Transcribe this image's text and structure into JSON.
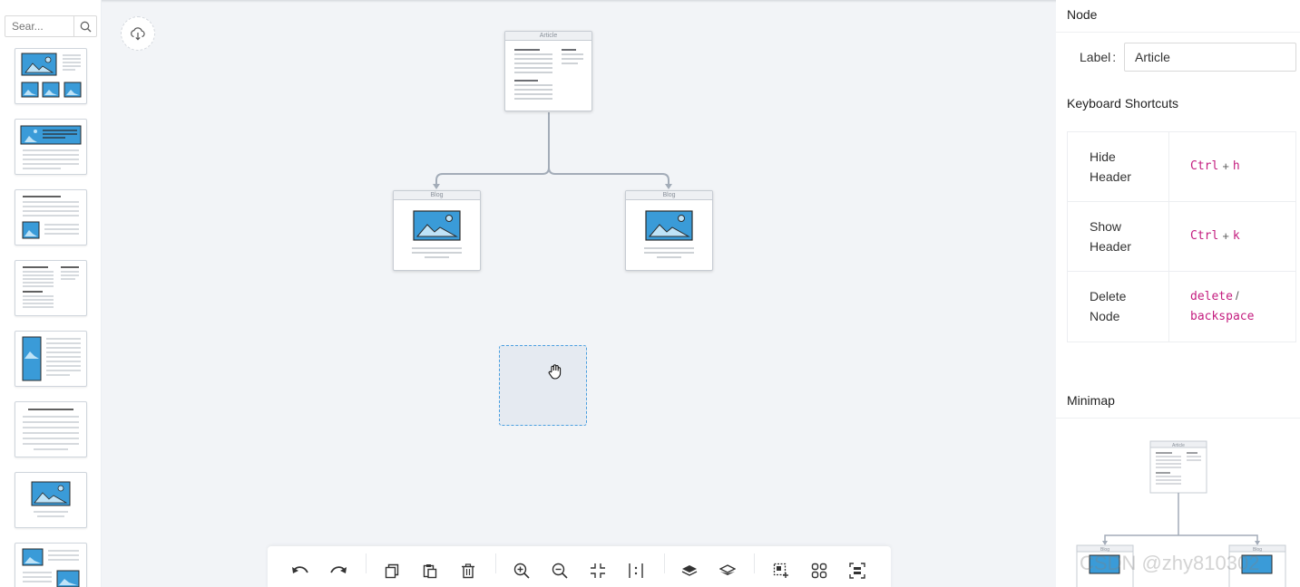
{
  "sidebar": {
    "search": {
      "placeholder": "Sear..."
    },
    "templates": [
      "template-hero-with-gallery",
      "template-banner-text",
      "template-text-image",
      "template-two-column-text",
      "template-image-left-text",
      "template-text-only",
      "template-single-image",
      "template-image-grid"
    ]
  },
  "canvas": {
    "nodes": [
      {
        "id": "article",
        "title": "Article"
      },
      {
        "id": "blog-left",
        "title": "Blog"
      },
      {
        "id": "blog-right",
        "title": "Blog"
      }
    ]
  },
  "toolbar": {
    "icons": [
      "undo-icon",
      "redo-icon",
      "copy-icon",
      "paste-icon",
      "delete-icon",
      "zoom-in-icon",
      "zoom-out-icon",
      "fit-view-icon",
      "actual-size-icon",
      "bring-to-front-icon",
      "send-to-back-icon",
      "multi-select-icon",
      "group-icon",
      "ungroup-icon"
    ]
  },
  "panel": {
    "node_section_title": "Node",
    "label_caption": "Label",
    "label_colon": ":",
    "label_value": "Article",
    "shortcuts_title": "Keyboard Shortcuts",
    "shortcuts": [
      {
        "action_line1": "Hide",
        "action_line2": "Header",
        "key1": "Ctrl",
        "joiner": "+",
        "key2": "h"
      },
      {
        "action_line1": "Show",
        "action_line2": "Header",
        "key1": "Ctrl",
        "joiner": "+",
        "key2": "k"
      },
      {
        "action_line1": "Delete",
        "action_line2": "Node",
        "key1": "delete",
        "joiner": "/",
        "key2": "backspace"
      }
    ],
    "minimap_title": "Minimap",
    "minimap_nodes": [
      "Article",
      "Blog",
      "Blog"
    ]
  },
  "watermark": "CSDN @zhy810302",
  "colors": {
    "accent_blue": "#3a9bd8",
    "canvas_bg": "#f2f4f7",
    "kbd_magenta": "#c41d7f"
  }
}
